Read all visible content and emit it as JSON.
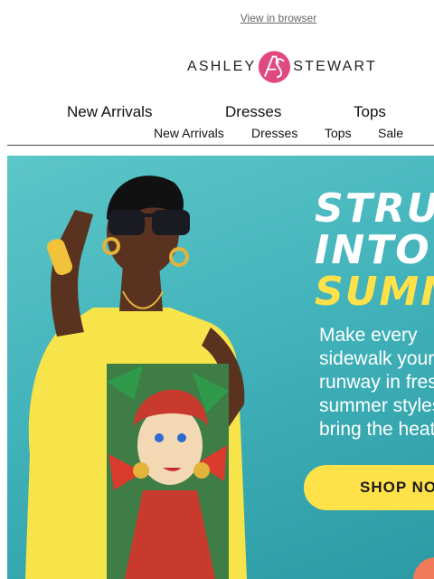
{
  "header": {
    "view_in_browser": "View in browser",
    "brand_left": "ASHLEY",
    "brand_right": "STEWART",
    "brand_accent": "#e0497f"
  },
  "nav_primary": [
    "New Arrivals",
    "Dresses",
    "Tops"
  ],
  "nav_secondary": [
    "New Arrivals",
    "Dresses",
    "Tops",
    "Sale"
  ],
  "hero": {
    "headline": [
      "STRUT",
      "INTO",
      "SUMMER"
    ],
    "body": [
      "Make every",
      "sidewalk your",
      "runway in fresh",
      "summer styles",
      "bring the heat"
    ],
    "cta": "SHOP NOW",
    "bg_color": "#43b4bb",
    "accent_color": "#ffe14a"
  }
}
